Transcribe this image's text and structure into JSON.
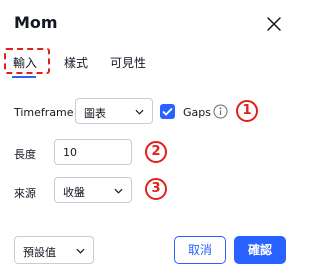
{
  "dialog": {
    "title": "Mom"
  },
  "tabs": [
    {
      "label": "輸入",
      "active": true
    },
    {
      "label": "樣式",
      "active": false
    },
    {
      "label": "可見性",
      "active": false
    }
  ],
  "inputs": {
    "timeframe_label": "Timeframe",
    "timeframe_value": "圖表",
    "gaps_label": "Gaps",
    "gaps_checked": true,
    "length_label": "長度",
    "length_value": "10",
    "source_label": "來源",
    "source_value": "收盤"
  },
  "markers": [
    "1",
    "2",
    "3"
  ],
  "footer": {
    "defaults_label": "預設值",
    "cancel_label": "取消",
    "ok_label": "確認"
  },
  "colors": {
    "accent": "#2962ff",
    "annotation": "#e0211b"
  }
}
